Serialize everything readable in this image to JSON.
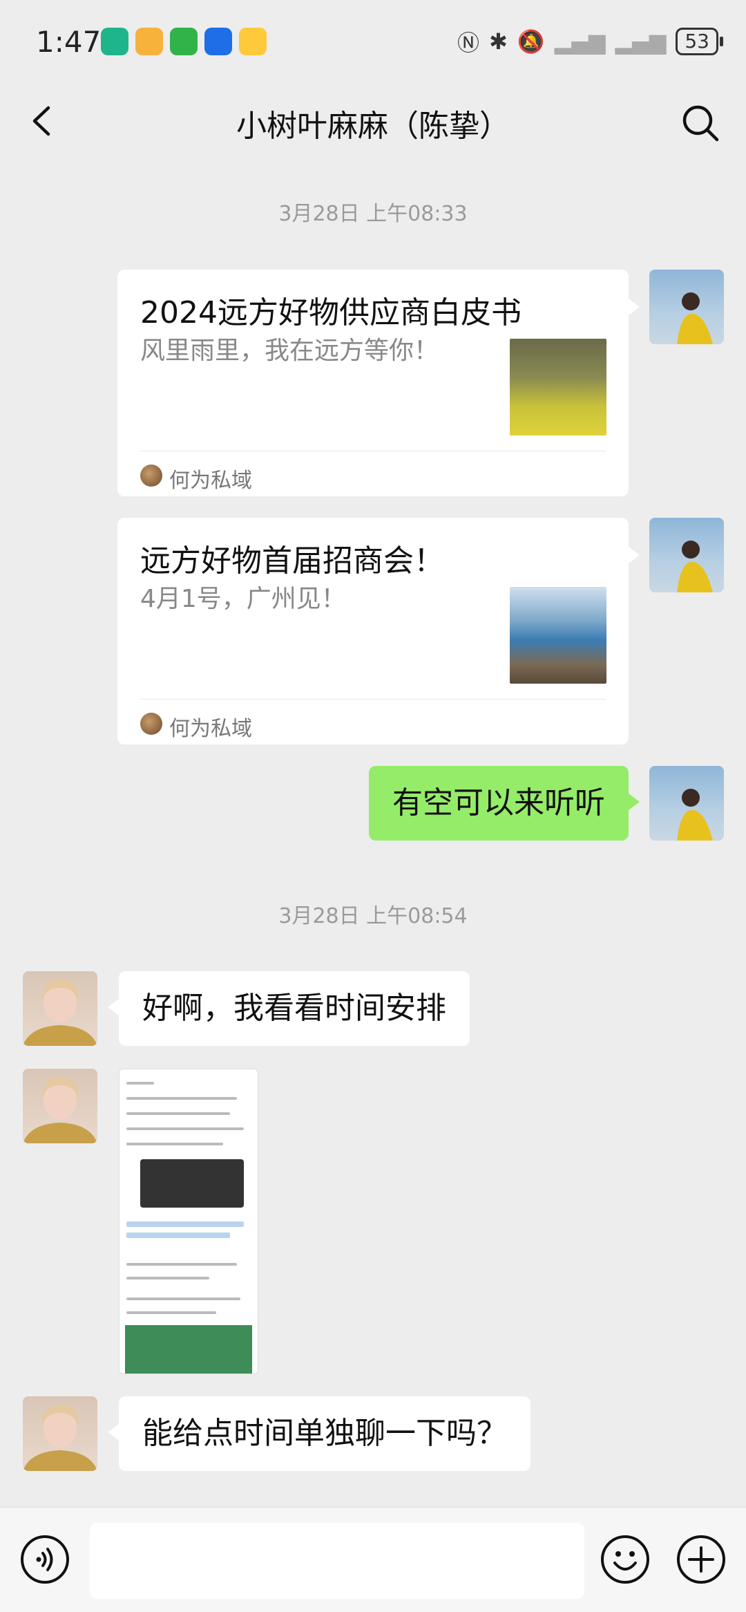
{
  "status_bar": {
    "time": "1:47",
    "battery": "53"
  },
  "header": {
    "title": "小树叶麻麻（陈挚）"
  },
  "messages": {
    "ts1": "3月28日 上午08:33",
    "card1": {
      "title": "2024远方好物供应商白皮书",
      "desc": "风里雨里，我在远方等你！",
      "source": "何为私域"
    },
    "card2": {
      "title": "远方好物首届招商会！",
      "desc": "4月1号，广州见！",
      "source": "何为私域"
    },
    "sent1": "有空可以来听听",
    "ts2": "3月28日 上午08:54",
    "recv1": "好啊，我看看时间安排",
    "recv2": "能给点时间单独聊一下吗？"
  },
  "colors": {
    "bubble_sent": "#95ec69",
    "background": "#ededed"
  }
}
